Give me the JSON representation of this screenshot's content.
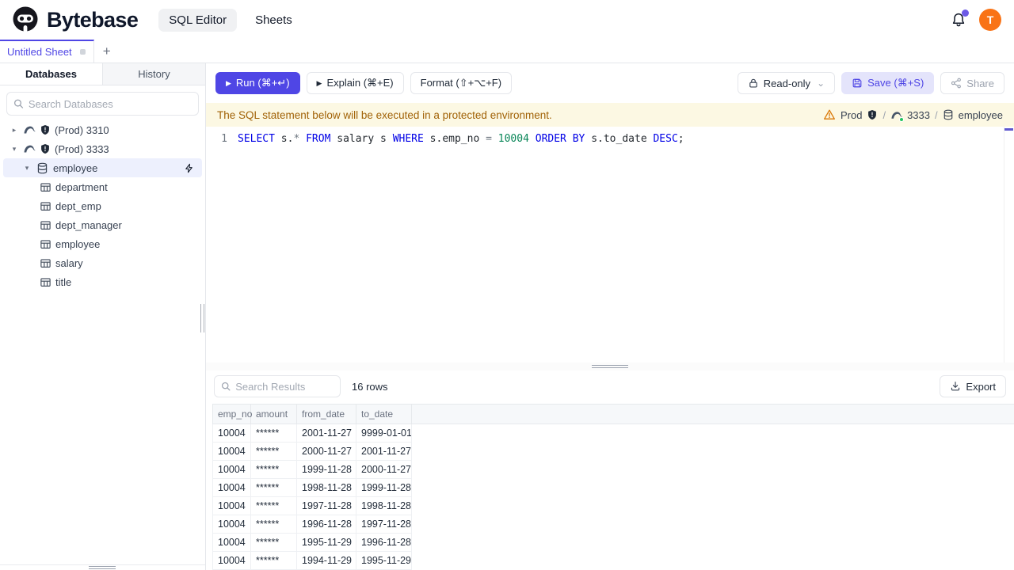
{
  "colors": {
    "accent": "#4f46e5",
    "run_button_bg": "#4f46e5",
    "save_button_bg": "#e4e4fb",
    "avatar_bg": "#f97316",
    "notification_dot": "#6d5ae6",
    "banner_bg": "#fcf8e3",
    "banner_text": "#a16207",
    "sql_keyword": "#0000e6",
    "sql_number": "#098658",
    "selected_tree_bg": "#edf0fd",
    "status_green": "#22c55e"
  },
  "icons": {
    "play": "▶",
    "plus": "+",
    "chevron_down": "⌄",
    "caret_right": "▸",
    "caret_down": "▾",
    "slash": "/"
  },
  "topnav": {
    "brand": "Bytebase",
    "tabs": [
      {
        "label": "SQL Editor"
      },
      {
        "label": "Sheets"
      }
    ],
    "avatar_initial": "T"
  },
  "sheet_tab": {
    "title": "Untitled Sheet"
  },
  "sidebar": {
    "tabs": [
      {
        "label": "Databases"
      },
      {
        "label": "History"
      }
    ],
    "search_placeholder": "Search Databases",
    "instances": [
      {
        "label": "(Prod) 3310"
      },
      {
        "label": "(Prod) 3333"
      }
    ],
    "database": "employee",
    "tables": [
      "department",
      "dept_emp",
      "dept_manager",
      "employee",
      "salary",
      "title"
    ]
  },
  "toolbar": {
    "run": "Run (⌘+↵)",
    "explain": "Explain (⌘+E)",
    "format": "Format (⇧+⌥+F)",
    "readonly": "Read-only",
    "save": "Save (⌘+S)",
    "share": "Share"
  },
  "banner": {
    "message": "The SQL statement below will be executed in a protected environment.",
    "environment": "Prod",
    "instance": "3333",
    "database": "employee"
  },
  "editor": {
    "line_number": "1",
    "sql": "SELECT s.* FROM salary s WHERE s.emp_no = 10004 ORDER BY s.to_date DESC;",
    "tokens": [
      {
        "t": "SELECT",
        "c": "keyword"
      },
      {
        "t": " s.",
        "c": "plain"
      },
      {
        "t": "*",
        "c": "operator"
      },
      {
        "t": " ",
        "c": "plain"
      },
      {
        "t": "FROM",
        "c": "keyword"
      },
      {
        "t": " salary s ",
        "c": "plain"
      },
      {
        "t": "WHERE",
        "c": "keyword"
      },
      {
        "t": " s.emp_no ",
        "c": "plain"
      },
      {
        "t": "=",
        "c": "operator"
      },
      {
        "t": " ",
        "c": "plain"
      },
      {
        "t": "10004",
        "c": "number"
      },
      {
        "t": " ",
        "c": "plain"
      },
      {
        "t": "ORDER BY",
        "c": "keyword"
      },
      {
        "t": " s.to_date ",
        "c": "plain"
      },
      {
        "t": "DESC",
        "c": "keyword"
      },
      {
        "t": ";",
        "c": "plain"
      }
    ]
  },
  "results": {
    "search_placeholder": "Search Results",
    "row_count": "16 rows",
    "export": "Export",
    "columns": [
      "emp_no",
      "amount",
      "from_date",
      "to_date"
    ],
    "rows": [
      [
        "10004",
        "******",
        "2001-11-27",
        "9999-01-01"
      ],
      [
        "10004",
        "******",
        "2000-11-27",
        "2001-11-27"
      ],
      [
        "10004",
        "******",
        "1999-11-28",
        "2000-11-27"
      ],
      [
        "10004",
        "******",
        "1998-11-28",
        "1999-11-28"
      ],
      [
        "10004",
        "******",
        "1997-11-28",
        "1998-11-28"
      ],
      [
        "10004",
        "******",
        "1996-11-28",
        "1997-11-28"
      ],
      [
        "10004",
        "******",
        "1995-11-29",
        "1996-11-28"
      ],
      [
        "10004",
        "******",
        "1994-11-29",
        "1995-11-29"
      ]
    ]
  }
}
